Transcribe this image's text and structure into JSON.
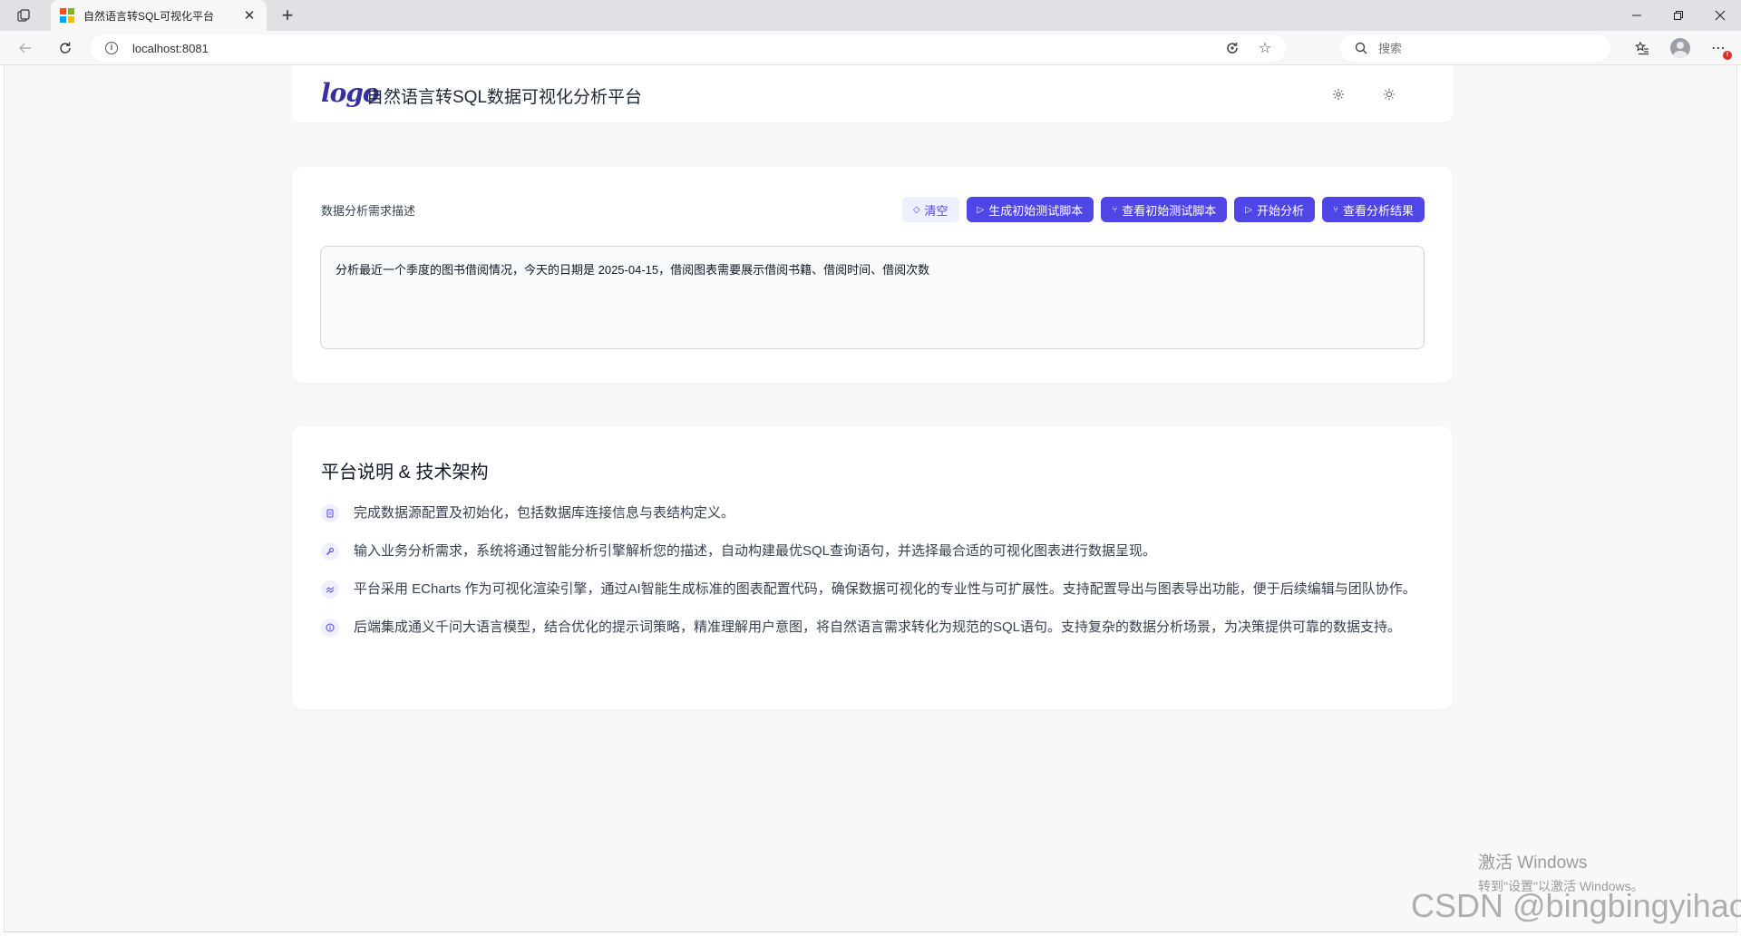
{
  "browser": {
    "tab_title": "自然语言转SQL可视化平台",
    "tab_close": "✕",
    "new_tab": "+",
    "url": "localhost:8081",
    "search_placeholder": "搜索",
    "favicon_colors": [
      "#f25022",
      "#7fba00",
      "#00a4ef",
      "#ffb900"
    ],
    "notification_badge": "!"
  },
  "app": {
    "logo_text": "logo",
    "title": "自然语言转SQL数据可视化分析平台",
    "accent_color": "#4f46e5"
  },
  "input_card": {
    "label": "数据分析需求描述",
    "buttons": {
      "clear": "清空",
      "generate_script": "生成初始测试脚本",
      "view_script": "查看初始测试脚本",
      "start_analysis": "开始分析",
      "view_result": "查看分析结果"
    },
    "requirement_text": "分析最近一个季度的图书借阅情况，今天的日期是 2025-04-15，借阅图表需要展示借阅书籍、借阅时间、借阅次数"
  },
  "info_card": {
    "title": "平台说明 & 技术架构",
    "items": [
      {
        "icon": "database-icon",
        "text": "完成数据源配置及初始化，包括数据库连接信息与表结构定义。"
      },
      {
        "icon": "wrench-icon",
        "text": "输入业务分析需求，系统将通过智能分析引擎解析您的描述，自动构建最优SQL查询语句，并选择最合适的可视化图表进行数据呈现。"
      },
      {
        "icon": "chart-line-icon",
        "text": "平台采用 ECharts 作为可视化渲染引擎，通过AI智能生成标准的图表配置代码，确保数据可视化的专业性与可扩展性。支持配置导出与图表导出功能，便于后续编辑与团队协作。"
      },
      {
        "icon": "info-icon",
        "text": "后端集成通义千问大语言模型，结合优化的提示词策略，精准理解用户意图，将自然语言需求转化为规范的SQL语句。支持复杂的数据分析场景，为决策提供可靠的数据支持。"
      }
    ]
  },
  "watermarks": {
    "windows_line1": "激活 Windows",
    "windows_line2": "转到\"设置\"以激活 Windows。",
    "csdn": "CSDN @bingbingyihao"
  }
}
